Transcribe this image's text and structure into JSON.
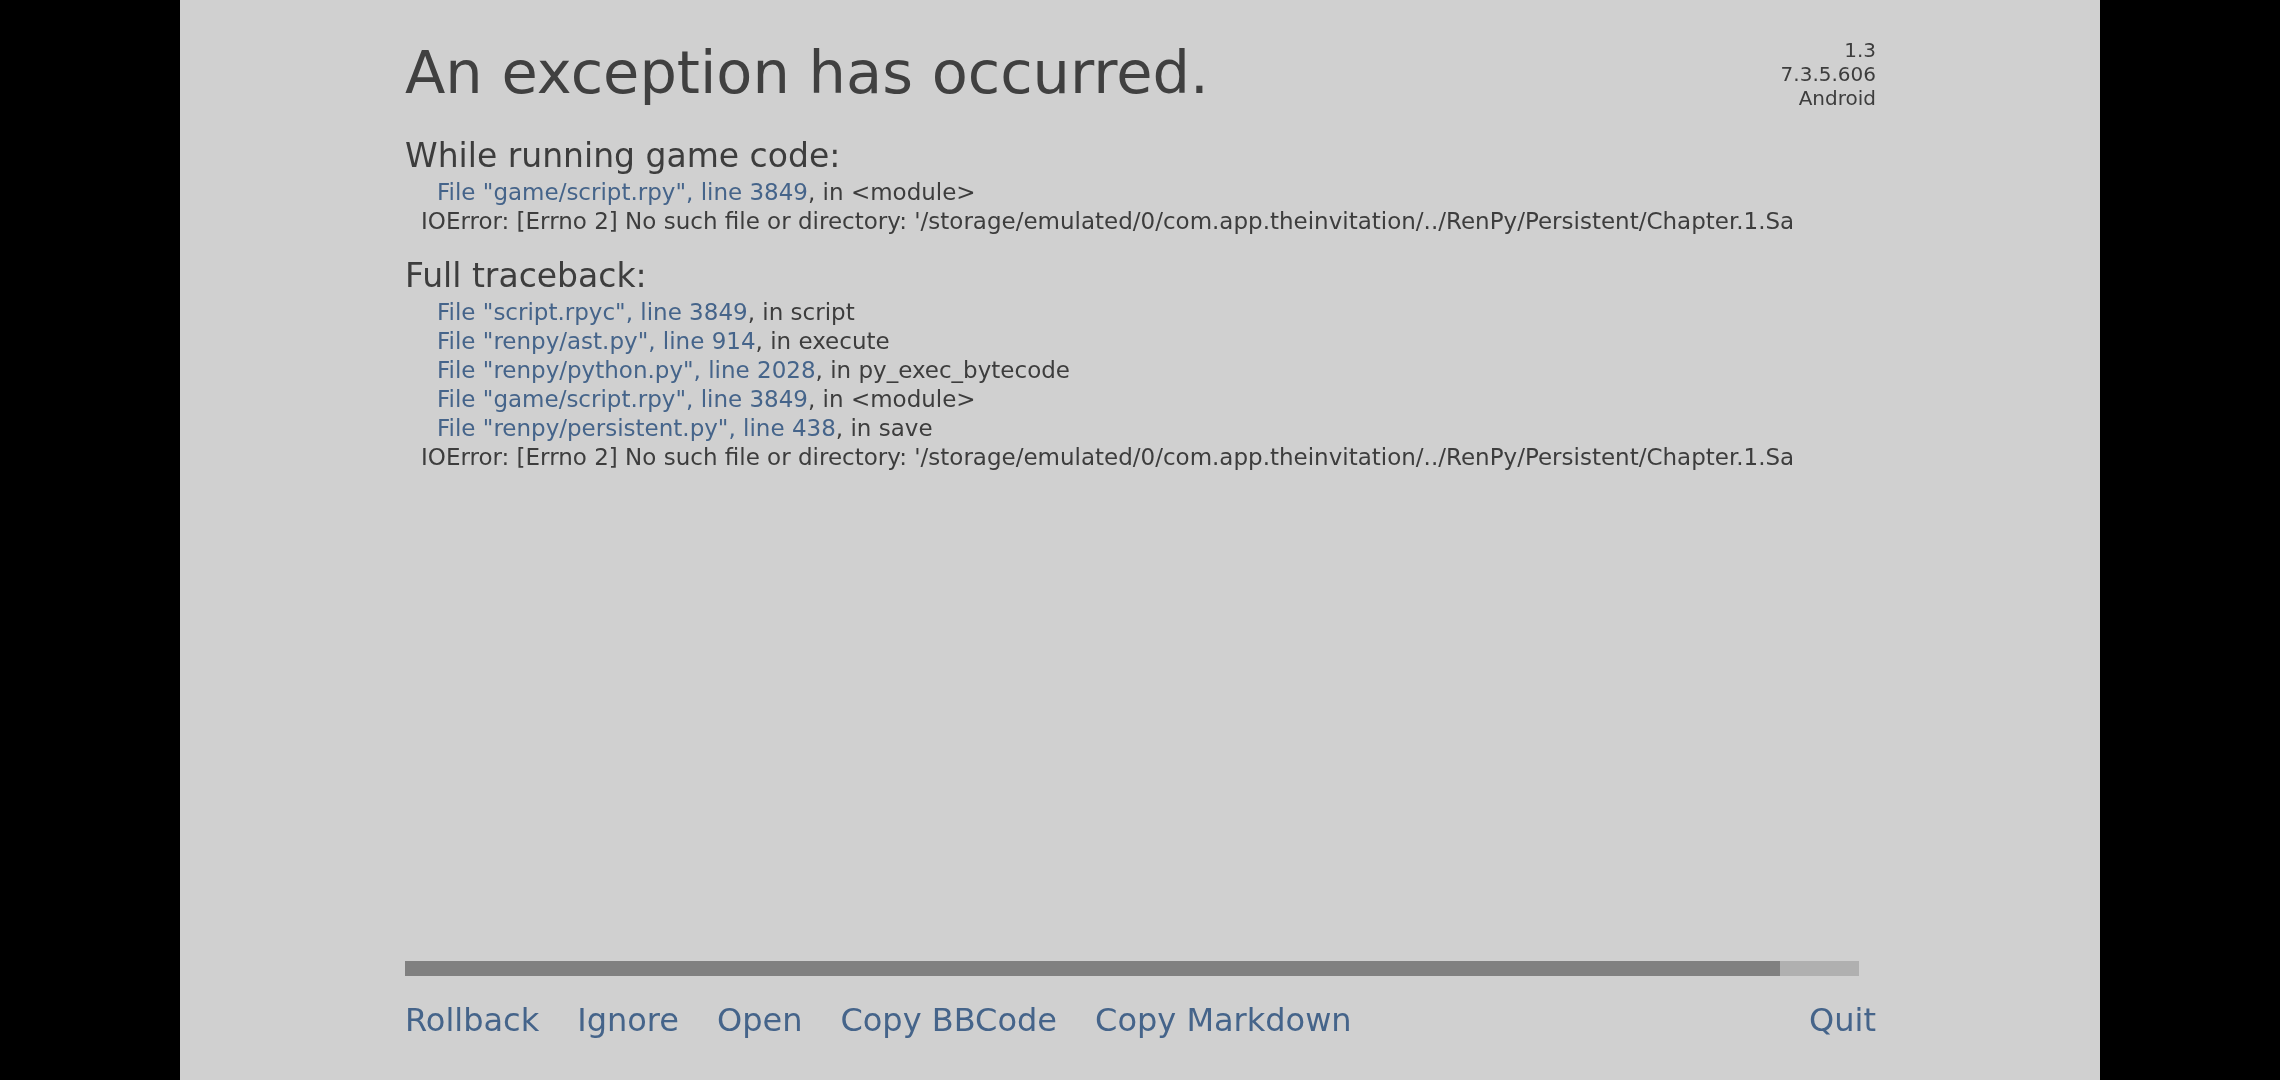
{
  "header": {
    "title": "An exception has occurred.",
    "version_info": [
      "1.3",
      "7.3.5.606",
      "Android"
    ]
  },
  "sections": [
    {
      "heading": "While running game code:",
      "frames": [
        {
          "location": "File \"game/script.rpy\", line 3849",
          "context": ", in <module>"
        }
      ],
      "error": "IOError: [Errno 2] No such file or directory: '/storage/emulated/0/com.app.theinvitation/../RenPy/Persistent/Chapter.1.Sa"
    },
    {
      "heading": "Full traceback:",
      "frames": [
        {
          "location": "File \"script.rpyc\", line 3849",
          "context": ", in script"
        },
        {
          "location": "File \"renpy/ast.py\", line 914",
          "context": ", in execute"
        },
        {
          "location": "File \"renpy/python.py\", line 2028",
          "context": ", in py_exec_bytecode"
        },
        {
          "location": "File \"game/script.rpy\", line 3849",
          "context": ", in <module>"
        },
        {
          "location": "File \"renpy/persistent.py\", line 438",
          "context": ", in save"
        }
      ],
      "error": "IOError: [Errno 2] No such file or directory: '/storage/emulated/0/com.app.theinvitation/../RenPy/Persistent/Chapter.1.Sa"
    }
  ],
  "actions": [
    "Rollback",
    "Ignore",
    "Open",
    "Copy BBCode",
    "Copy Markdown"
  ],
  "quit": "Quit"
}
